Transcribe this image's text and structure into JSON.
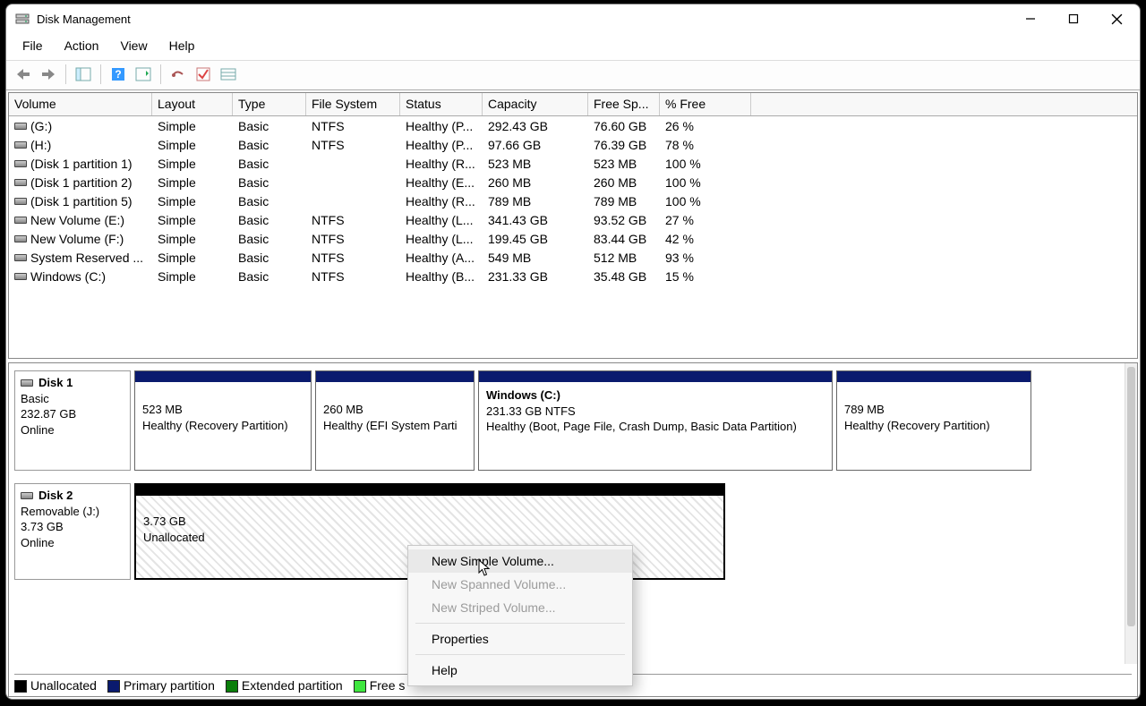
{
  "window": {
    "title": "Disk Management"
  },
  "menu": {
    "file": "File",
    "action": "Action",
    "view": "View",
    "help": "Help"
  },
  "columns": {
    "volume": "Volume",
    "layout": "Layout",
    "type": "Type",
    "filesystem": "File System",
    "status": "Status",
    "capacity": "Capacity",
    "freespace": "Free Sp...",
    "pctfree": "% Free"
  },
  "volumes": [
    {
      "name": "(G:)",
      "layout": "Simple",
      "type": "Basic",
      "fs": "NTFS",
      "status": "Healthy (P...",
      "capacity": "292.43 GB",
      "free": "76.60 GB",
      "pct": "26 %"
    },
    {
      "name": "(H:)",
      "layout": "Simple",
      "type": "Basic",
      "fs": "NTFS",
      "status": "Healthy (P...",
      "capacity": "97.66 GB",
      "free": "76.39 GB",
      "pct": "78 %"
    },
    {
      "name": "(Disk 1 partition 1)",
      "layout": "Simple",
      "type": "Basic",
      "fs": "",
      "status": "Healthy (R...",
      "capacity": "523 MB",
      "free": "523 MB",
      "pct": "100 %"
    },
    {
      "name": "(Disk 1 partition 2)",
      "layout": "Simple",
      "type": "Basic",
      "fs": "",
      "status": "Healthy (E...",
      "capacity": "260 MB",
      "free": "260 MB",
      "pct": "100 %"
    },
    {
      "name": "(Disk 1 partition 5)",
      "layout": "Simple",
      "type": "Basic",
      "fs": "",
      "status": "Healthy (R...",
      "capacity": "789 MB",
      "free": "789 MB",
      "pct": "100 %"
    },
    {
      "name": "New Volume (E:)",
      "layout": "Simple",
      "type": "Basic",
      "fs": "NTFS",
      "status": "Healthy (L...",
      "capacity": "341.43 GB",
      "free": "93.52 GB",
      "pct": "27 %"
    },
    {
      "name": "New Volume (F:)",
      "layout": "Simple",
      "type": "Basic",
      "fs": "NTFS",
      "status": "Healthy (L...",
      "capacity": "199.45 GB",
      "free": "83.44 GB",
      "pct": "42 %"
    },
    {
      "name": "System Reserved ...",
      "layout": "Simple",
      "type": "Basic",
      "fs": "NTFS",
      "status": "Healthy (A...",
      "capacity": "549 MB",
      "free": "512 MB",
      "pct": "93 %"
    },
    {
      "name": "Windows (C:)",
      "layout": "Simple",
      "type": "Basic",
      "fs": "NTFS",
      "status": "Healthy (B...",
      "capacity": "231.33 GB",
      "free": "35.48 GB",
      "pct": "15 %"
    }
  ],
  "graph": {
    "disk1": {
      "title": "Disk 1",
      "type": "Basic",
      "size": "232.87 GB",
      "state": "Online",
      "parts": [
        {
          "title": "",
          "line1": "523 MB",
          "line2": "Healthy (Recovery Partition)"
        },
        {
          "title": "",
          "line1": "260 MB",
          "line2": "Healthy (EFI System Parti"
        },
        {
          "title": "Windows  (C:)",
          "line1": "231.33 GB NTFS",
          "line2": "Healthy (Boot, Page File, Crash Dump, Basic Data Partition)"
        },
        {
          "title": "",
          "line1": "789 MB",
          "line2": "Healthy (Recovery Partition)"
        }
      ]
    },
    "disk2": {
      "title": "Disk 2",
      "type": "Removable (J:)",
      "size": "3.73 GB",
      "state": "Online",
      "part": {
        "line1": "3.73 GB",
        "line2": "Unallocated"
      }
    }
  },
  "legend": {
    "unallocated": "Unallocated",
    "primary": "Primary partition",
    "extended": "Extended partition",
    "free": "Free s"
  },
  "context_menu": {
    "new_simple": "New Simple Volume...",
    "new_spanned": "New Spanned Volume...",
    "new_striped": "New Striped Volume...",
    "properties": "Properties",
    "help": "Help"
  }
}
